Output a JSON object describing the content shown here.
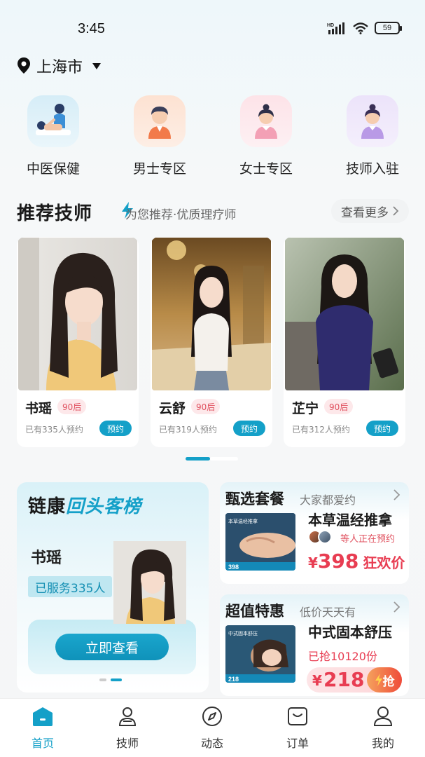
{
  "status_bar": {
    "time": "3:45",
    "network": "HD",
    "battery": "59"
  },
  "location": {
    "city": "上海市"
  },
  "categories": [
    {
      "label": "中医保健",
      "icon": "massage-icon"
    },
    {
      "label": "男士专区",
      "icon": "male-avatar-icon"
    },
    {
      "label": "女士专区",
      "icon": "female-avatar-icon"
    },
    {
      "label": "技师入驻",
      "icon": "therapist-join-icon"
    }
  ],
  "recommend": {
    "title": "推荐技师",
    "subtitle": "为您推荐·优质理疗师",
    "more": "查看更多",
    "therapists": [
      {
        "name": "书瑶",
        "age_tag": "90后",
        "booked": "已有335人预约",
        "book_label": "预约"
      },
      {
        "name": "云舒",
        "age_tag": "90后",
        "booked": "已有319人预约",
        "book_label": "预约"
      },
      {
        "name": "芷宁",
        "age_tag": "90后",
        "booked": "已有312人预约",
        "book_label": "预约"
      }
    ]
  },
  "repeat_board": {
    "title_prefix": "链康",
    "title_highlight": "回头客榜",
    "name": "书瑶",
    "served": "已服务335人",
    "view_button": "立即查看"
  },
  "selected_package": {
    "title": "甄选套餐",
    "subtitle": "大家都爱约",
    "item_name": "本草温经推拿",
    "note": "等人正在预约",
    "currency": "¥",
    "price": "398",
    "price_tag": "狂欢价",
    "image_text": "本草温经推拿",
    "image_price": "398"
  },
  "value_deal": {
    "title": "超值特惠",
    "subtitle": "低价天天有",
    "item_name": "中式固本舒压",
    "grabbed": "已抢10120份",
    "currency": "¥",
    "price": "218",
    "grab_label": "抢",
    "image_text": "中式固本舒压",
    "image_price": "218"
  },
  "tabbar": [
    {
      "label": "首页",
      "icon": "home-icon",
      "active": true
    },
    {
      "label": "技师",
      "icon": "therapist-icon",
      "active": false
    },
    {
      "label": "动态",
      "icon": "compass-icon",
      "active": false
    },
    {
      "label": "订单",
      "icon": "order-icon",
      "active": false
    },
    {
      "label": "我的",
      "icon": "profile-icon",
      "active": false
    }
  ],
  "colors": {
    "accent": "#14a0c8",
    "price_red": "#e83d52",
    "age_badge_bg": "#fde8ea"
  }
}
